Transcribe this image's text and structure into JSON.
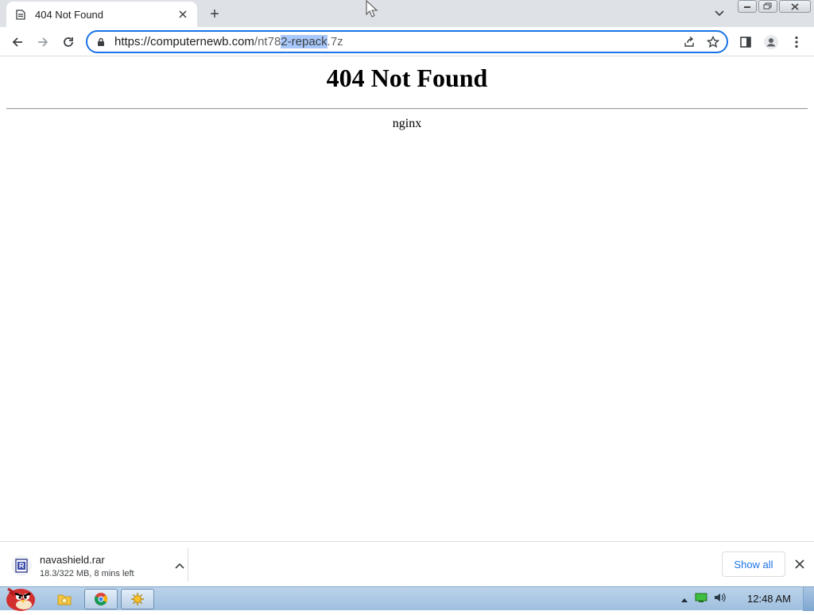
{
  "browser": {
    "tab": {
      "title": "404 Not Found"
    },
    "new_tab_label": "+",
    "address_bar": {
      "url_host": "https://computernewb.com",
      "url_path_pre": "/nt78",
      "url_path_selected": "2-repack",
      "url_path_post": ".7z"
    }
  },
  "page": {
    "heading": "404 Not Found",
    "server": "nginx"
  },
  "download_shelf": {
    "item": {
      "filename": "navashield.rar",
      "status": "18.3/322 MB, 8 mins left"
    },
    "show_all_label": "Show all"
  },
  "taskbar": {
    "clock": "12:48 AM"
  },
  "colors": {
    "accent": "#1a73e8",
    "selection": "#a8c7fa"
  }
}
